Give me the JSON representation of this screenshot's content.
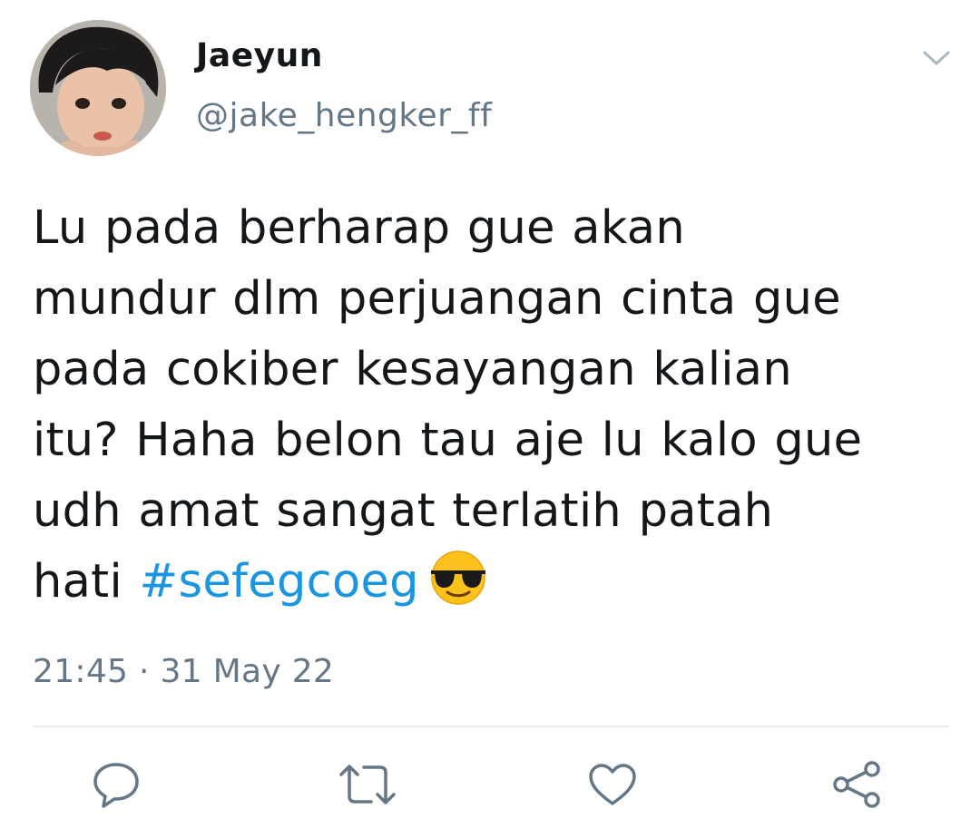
{
  "user": {
    "display_name": "Jaeyun",
    "handle": "@jake_hengker_ff",
    "avatar_icon": "profile-photo"
  },
  "tweet": {
    "lines": [
      "Lu pada berharap gue akan",
      "mundur dlm perjuangan cinta gue",
      "pada cokiber kesayangan kalian",
      "itu? Haha belon tau aje lu kalo gue",
      "udh amat sangat terlatih patah"
    ],
    "last_line_prefix": "hati ",
    "hashtag": "#sefegcoeg",
    "emoji": "smiling-face-with-sunglasses",
    "timestamp": "21:45 · 31 May 22"
  },
  "actions": {
    "reply_icon": "reply-icon",
    "retweet_icon": "retweet-icon",
    "like_icon": "like-icon",
    "share_icon": "share-icon"
  },
  "colors": {
    "text": "#14171a",
    "secondary": "#657786",
    "hashtag": "#1b95e0",
    "icon": "#657786",
    "divider": "#e6ecf0"
  }
}
